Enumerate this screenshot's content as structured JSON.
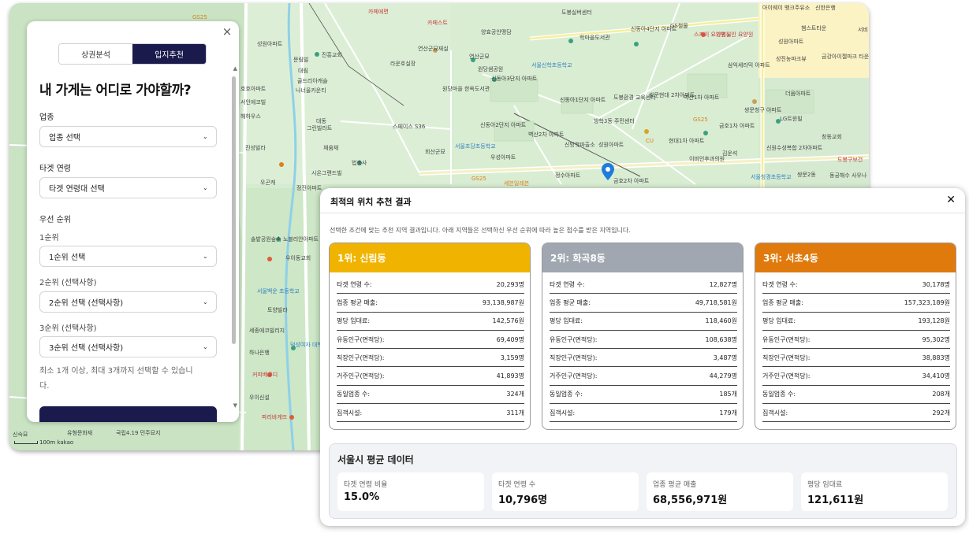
{
  "map": {
    "labels": [
      {
        "text": "GS25",
        "cls": "orange"
      },
      {
        "text": "성원아파트",
        "cls": ""
      },
      {
        "text": "진흥교회",
        "cls": ""
      },
      {
        "text": "문림빌",
        "cls": ""
      },
      {
        "text": "대림",
        "cls": ""
      },
      {
        "text": "골드리아캐슬",
        "cls": ""
      },
      {
        "text": "나너울카운티",
        "cls": ""
      },
      {
        "text": "호호아파트",
        "cls": ""
      },
      {
        "text": "서인에코빌",
        "cls": ""
      },
      {
        "text": "해하우스",
        "cls": ""
      },
      {
        "text": "대동",
        "cls": ""
      },
      {
        "text": "그린빌라트",
        "cls": ""
      },
      {
        "text": "진성빌라",
        "cls": ""
      },
      {
        "text": "채움채",
        "cls": ""
      },
      {
        "text": "시온그랜드빌",
        "cls": ""
      },
      {
        "text": "법충사",
        "cls": ""
      },
      {
        "text": "정진아파트",
        "cls": ""
      },
      {
        "text": "카페에면",
        "cls": "red"
      },
      {
        "text": "카페스트",
        "cls": "red"
      },
      {
        "text": "연산군묘재실",
        "cls": ""
      },
      {
        "text": "연산군묘",
        "cls": ""
      },
      {
        "text": "라운호실장",
        "cls": ""
      },
      {
        "text": "양효공안맹담",
        "cls": ""
      },
      {
        "text": "원당샘공원",
        "cls": ""
      },
      {
        "text": "원당마을 한옥도서관",
        "cls": ""
      },
      {
        "text": "신동아3단지 아파트",
        "cls": ""
      },
      {
        "text": "스페이스 S36",
        "cls": ""
      },
      {
        "text": "회산군묘",
        "cls": ""
      },
      {
        "text": "서울초당초등학교",
        "cls": "blue"
      },
      {
        "text": "신동아2단지 아파트",
        "cls": ""
      },
      {
        "text": "우성아파트",
        "cls": ""
      },
      {
        "text": "GS25",
        "cls": "orange"
      },
      {
        "text": "세븐일레븐",
        "cls": "orange"
      },
      {
        "text": "정수아파트",
        "cls": ""
      },
      {
        "text": "도봉실버센터",
        "cls": ""
      },
      {
        "text": "학마을도서관",
        "cls": ""
      },
      {
        "text": "신동아4단지 아파트",
        "cls": ""
      },
      {
        "text": "GS철물",
        "cls": ""
      },
      {
        "text": "서울신학초등학교",
        "cls": "blue"
      },
      {
        "text": "신동아1단지 아파트",
        "cls": ""
      },
      {
        "text": "도봉환경 교육센터",
        "cls": ""
      },
      {
        "text": "쌍문현대 2차아파트",
        "cls": ""
      },
      {
        "text": "벽산1차 아파트",
        "cls": ""
      },
      {
        "text": "벽산2차 아파트",
        "cls": ""
      },
      {
        "text": "신방학파출소",
        "cls": ""
      },
      {
        "text": "방학3동 주민센터",
        "cls": ""
      },
      {
        "text": "성원아파트",
        "cls": ""
      },
      {
        "text": "CU",
        "cls": "orange"
      },
      {
        "text": "현대1차 아파트",
        "cls": ""
      },
      {
        "text": "금호2차 아파트",
        "cls": ""
      },
      {
        "text": "스카이 요양병원",
        "cls": "red"
      },
      {
        "text": "가원노인 요양원",
        "cls": "red"
      },
      {
        "text": "삼익세라믹 아파트",
        "cls": ""
      },
      {
        "text": "쌍문청구 아파트",
        "cls": ""
      },
      {
        "text": "금호1차 아파트",
        "cls": ""
      },
      {
        "text": "GS25",
        "cls": "orange"
      },
      {
        "text": "LG트윈빌",
        "cls": ""
      },
      {
        "text": "신원수성복합 2차아파트",
        "cls": ""
      },
      {
        "text": "김운석",
        "cls": ""
      },
      {
        "text": "이비인후과의원",
        "cls": ""
      },
      {
        "text": "서울창경초등학교",
        "cls": "blue"
      },
      {
        "text": "쌍문2동",
        "cls": ""
      },
      {
        "text": "동궁해수 사우나",
        "cls": ""
      },
      {
        "text": "도봉구보건",
        "cls": "red"
      },
      {
        "text": "창동교회",
        "cls": ""
      },
      {
        "text": "더움아파트",
        "cls": ""
      },
      {
        "text": "성진농파크뷰",
        "cls": ""
      },
      {
        "text": "금강아이젤파크 타운아파트",
        "cls": ""
      },
      {
        "text": "챔스트타운",
        "cls": ""
      },
      {
        "text": "성원아파트",
        "cls": ""
      },
      {
        "text": "신한은행",
        "cls": ""
      },
      {
        "text": "아이웨이 뱅크주유소",
        "cls": ""
      },
      {
        "text": "서비",
        "cls": ""
      },
      {
        "text": "솔밭공원숲속 노블리안아파트",
        "cls": ""
      },
      {
        "text": "우이동교회",
        "cls": ""
      },
      {
        "text": "서울백운 초등학교",
        "cls": "blue"
      },
      {
        "text": "토양빌라",
        "cls": ""
      },
      {
        "text": "세종에코빌리지",
        "cls": ""
      },
      {
        "text": "덕성여자 대학교",
        "cls": "blue"
      },
      {
        "text": "하나은행",
        "cls": ""
      },
      {
        "text": "커피베우디",
        "cls": "red"
      },
      {
        "text": "국립4.19 민주묘지",
        "cls": ""
      },
      {
        "text": "유형문화재",
        "cls": ""
      },
      {
        "text": "파리바게뜨",
        "cls": "red"
      },
      {
        "text": "우이신설",
        "cls": ""
      },
      {
        "text": "신숙묘",
        "cls": ""
      },
      {
        "text": "우곤캐",
        "cls": ""
      }
    ],
    "scale_text": "100m",
    "logo": "kakao"
  },
  "panel": {
    "tabs": [
      {
        "label": "상권분석",
        "active": false
      },
      {
        "label": "입지추천",
        "active": true
      }
    ],
    "title": "내 가게는 어디로 가야할까?",
    "industry": {
      "label": "업종",
      "value": "업종 선택"
    },
    "target_age": {
      "label": "타겟 연령",
      "value": "타겟 연령대 선택"
    },
    "priority": {
      "label": "우선 순위",
      "first": {
        "label": "1순위",
        "value": "1순위 선택"
      },
      "second": {
        "label": "2순위 (선택사항)",
        "value": "2순위 선택 (선택사항)"
      },
      "third": {
        "label": "3순위 (선택사항)",
        "value": "3순위 선택 (선택사항)"
      }
    },
    "hint": "최소 1개 이상, 최대 3개까지 선택할 수 있습니다."
  },
  "result": {
    "title": "최적의 위치 추천 결과",
    "description": "선택한 조건에 맞는 추천 지역 결과입니다. 아래 지역들은 선택하신 우선 순위에 따라 높은 점수를 받은 지역입니다.",
    "cards": [
      {
        "title": "1위: 신림동",
        "color": "#f0b400",
        "rows": [
          {
            "label": "타겟 연령 수:",
            "value": "20,293명"
          },
          {
            "label": "업종 평균 매출:",
            "value": "93,138,987원"
          },
          {
            "label": "평당 임대료:",
            "value": "142,576원"
          },
          {
            "label": "유동인구(면적당):",
            "value": "69,409명"
          },
          {
            "label": "직장인구(면적당):",
            "value": "3,159명"
          },
          {
            "label": "거주인구(면적당):",
            "value": "41,893명"
          },
          {
            "label": "동일업종 수:",
            "value": "324개"
          },
          {
            "label": "집객시설:",
            "value": "311개"
          }
        ]
      },
      {
        "title": "2위: 화곡8동",
        "color": "#a0a7b0",
        "rows": [
          {
            "label": "타겟 연령 수:",
            "value": "12,827명"
          },
          {
            "label": "업종 평균 매출:",
            "value": "49,718,581원"
          },
          {
            "label": "평당 임대료:",
            "value": "118,460원"
          },
          {
            "label": "유동인구(면적당):",
            "value": "108,638명"
          },
          {
            "label": "직장인구(면적당):",
            "value": "3,487명"
          },
          {
            "label": "거주인구(면적당):",
            "value": "44,279명"
          },
          {
            "label": "동일업종 수:",
            "value": "185개"
          },
          {
            "label": "집객시설:",
            "value": "179개"
          }
        ]
      },
      {
        "title": "3위: 서초4동",
        "color": "#e07a0c",
        "rows": [
          {
            "label": "타겟 연령 수:",
            "value": "30,178명"
          },
          {
            "label": "업종 평균 매출:",
            "value": "157,323,189원"
          },
          {
            "label": "평당 임대료:",
            "value": "193,128원"
          },
          {
            "label": "유동인구(면적당):",
            "value": "95,302명"
          },
          {
            "label": "직장인구(면적당):",
            "value": "38,883명"
          },
          {
            "label": "거주인구(면적당):",
            "value": "34,410명"
          },
          {
            "label": "동일업종 수:",
            "value": "208개"
          },
          {
            "label": "집객시설:",
            "value": "292개"
          }
        ]
      }
    ],
    "average": {
      "title": "서울시 평균 데이터",
      "items": [
        {
          "label": "타겟 연령 비율",
          "value": "15.0%"
        },
        {
          "label": "타겟 연령 수",
          "value": "10,796명"
        },
        {
          "label": "업종 평균 매출",
          "value": "68,556,971원"
        },
        {
          "label": "평당 임대료",
          "value": "121,611원"
        }
      ]
    }
  }
}
